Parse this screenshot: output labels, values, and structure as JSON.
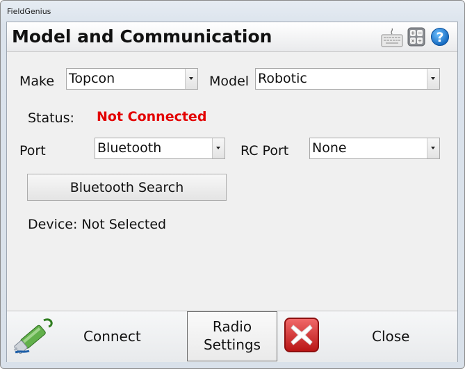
{
  "window": {
    "title": "FieldGenius"
  },
  "header": {
    "title": "Model and Communication",
    "icons": [
      "keyboard-icon",
      "calculator-icon",
      "help-icon"
    ]
  },
  "form": {
    "make_label": "Make",
    "make_value": "Topcon",
    "model_label": "Model",
    "model_value": "Robotic",
    "status_label": "Status:",
    "status_value": "Not Connected",
    "port_label": "Port",
    "port_value": "Bluetooth",
    "rc_port_label": "RC Port",
    "rc_port_value": "None",
    "bluetooth_search_label": "Bluetooth Search",
    "device_text": "Device: Not Selected"
  },
  "footer": {
    "connect_label": "Connect",
    "radio_settings_line1": "Radio",
    "radio_settings_line2": "Settings",
    "close_label": "Close"
  },
  "colors": {
    "status_red": "#e30000",
    "close_icon_red": "#d42020"
  }
}
